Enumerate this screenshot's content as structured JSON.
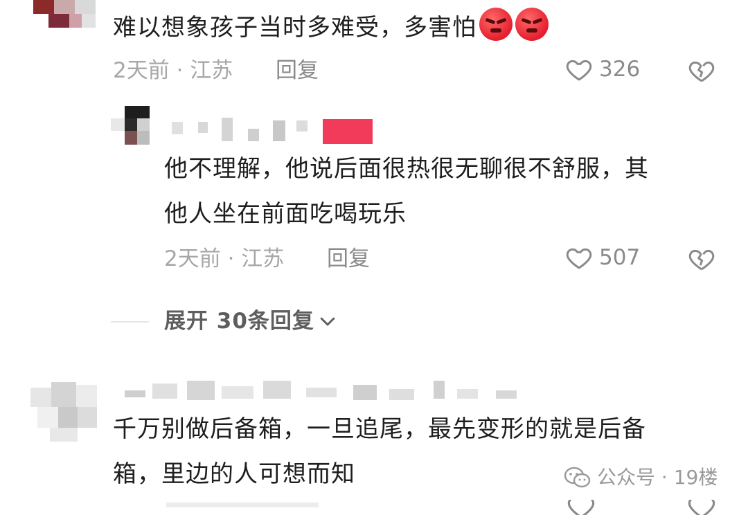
{
  "comment1": {
    "text": "难以想象孩子当时多难受，多害怕",
    "emoji": [
      "angry-face",
      "angry-face"
    ],
    "meta": "2天前 · 江苏",
    "reply_label": "回复",
    "likes": "326"
  },
  "reply1": {
    "text_line1": "他不理解，他说后面很热很无聊很不舒服，其",
    "text_line2": "他人坐在前面吃喝玩乐",
    "meta": "2天前 · 江苏",
    "reply_label": "回复",
    "likes": "507"
  },
  "expand": {
    "label": "展开 30条回复"
  },
  "comment2": {
    "text_line1": "千万别做后备箱，一旦追尾，最先变形的就是后备",
    "text_line2": "箱，里边的人可想而知"
  },
  "watermark": {
    "label": "公众号 · 19楼"
  },
  "colors": {
    "text": "#1e1e1e",
    "meta": "#a7a7a7",
    "emoji_red": "#e51e2e",
    "username_badge": "#f23a5a"
  }
}
